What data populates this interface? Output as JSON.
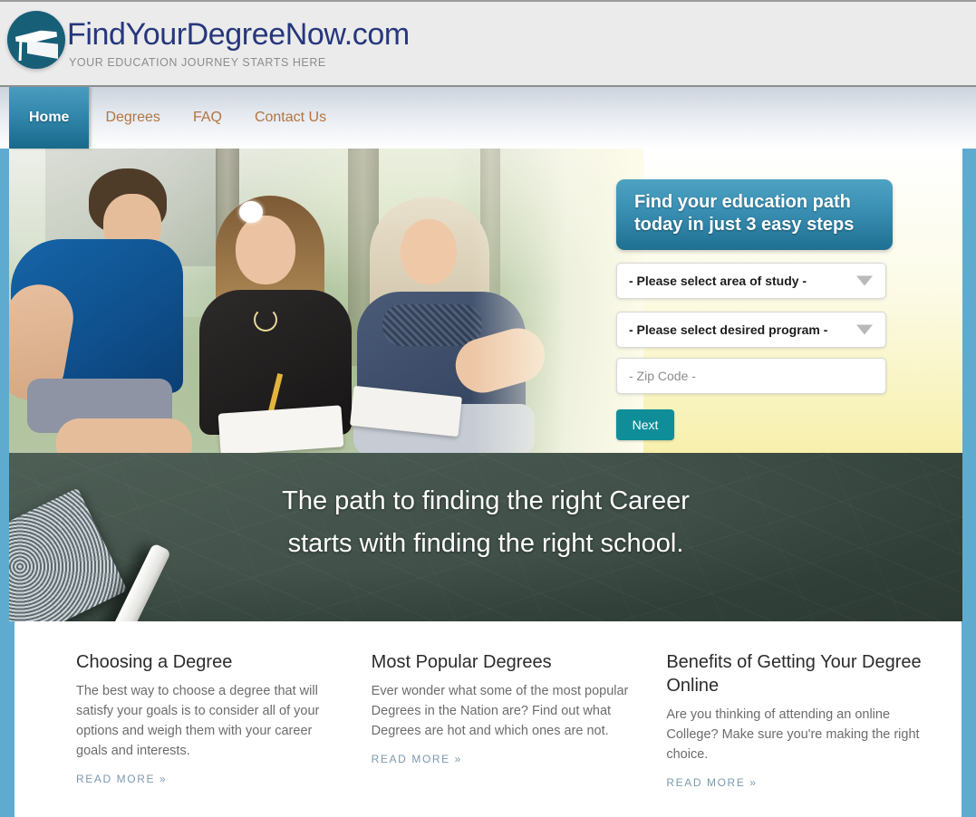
{
  "header": {
    "brand": "FindYourDegreeNow.com",
    "tagline": "YOUR EDUCATION JOURNEY STARTS HERE",
    "logo_icon": "graduation-cap-icon"
  },
  "nav": {
    "items": [
      {
        "label": "Home",
        "active": true
      },
      {
        "label": "Degrees",
        "active": false
      },
      {
        "label": "FAQ",
        "active": false
      },
      {
        "label": "Contact Us",
        "active": false
      }
    ]
  },
  "hero": {
    "form": {
      "title": "Find your education path today in just 3 easy steps",
      "area_of_study": "- Please select area of study -",
      "desired_program": "- Please select desired program -",
      "zip_placeholder": "- Zip Code -",
      "zip_value": "",
      "next_label": "Next",
      "caret_icon": "chevron-down-icon"
    }
  },
  "board": {
    "line1": "The path to finding the right Career",
    "line2": "starts with finding the right school."
  },
  "columns": [
    {
      "title": "Choosing a Degree",
      "body": "The best way to choose a degree that will satisfy your goals is to consider all of your options and weigh them with your career goals and interests.",
      "more": "READ MORE »"
    },
    {
      "title": "Most Popular Degrees",
      "body": "Ever wonder what some of the most popular Degrees in the Nation are? Find out what Degrees are hot and which ones are not.",
      "more": "READ MORE »"
    },
    {
      "title": "Benefits of Getting Your Degree Online",
      "body": "Are you thinking of attending an online College? Make sure you're making the right choice.",
      "more": "READ MORE »"
    }
  ],
  "colors": {
    "brand_text": "#26377c",
    "nav_link": "#b3743e",
    "accent_teal": "#0f8e99",
    "panel_blue": "#3b91b5",
    "rail_blue": "#5fabd0",
    "board_green": "#3a4b43"
  }
}
